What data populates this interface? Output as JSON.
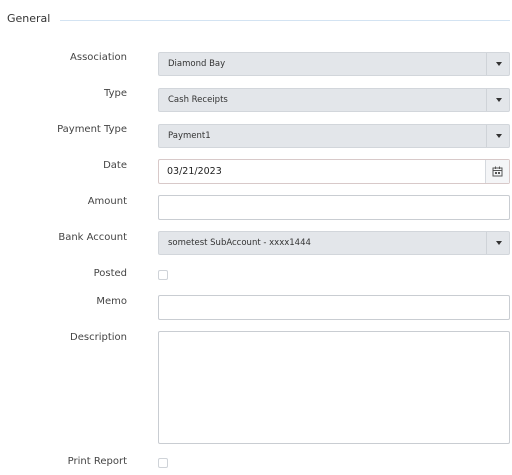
{
  "section": {
    "title": "General"
  },
  "fields": {
    "association": {
      "label": "Association",
      "value": "Diamond Bay"
    },
    "type": {
      "label": "Type",
      "value": "Cash Receipts"
    },
    "payment_type": {
      "label": "Payment Type",
      "value": "Payment1"
    },
    "date": {
      "label": "Date",
      "value": "03/21/2023"
    },
    "amount": {
      "label": "Amount",
      "value": ""
    },
    "bank_account": {
      "label": "Bank Account",
      "value": "sometest SubAccount - xxxx1444"
    },
    "posted": {
      "label": "Posted",
      "checked": false
    },
    "memo": {
      "label": "Memo",
      "value": ""
    },
    "description": {
      "label": "Description",
      "value": ""
    },
    "print_report": {
      "label": "Print Report",
      "checked": false
    }
  },
  "icons": {
    "dropdown": "chevron-down-icon",
    "calendar": "calendar-icon"
  },
  "colors": {
    "select_bg": "#e3e6ea",
    "section_line": "#d3e3f2"
  }
}
